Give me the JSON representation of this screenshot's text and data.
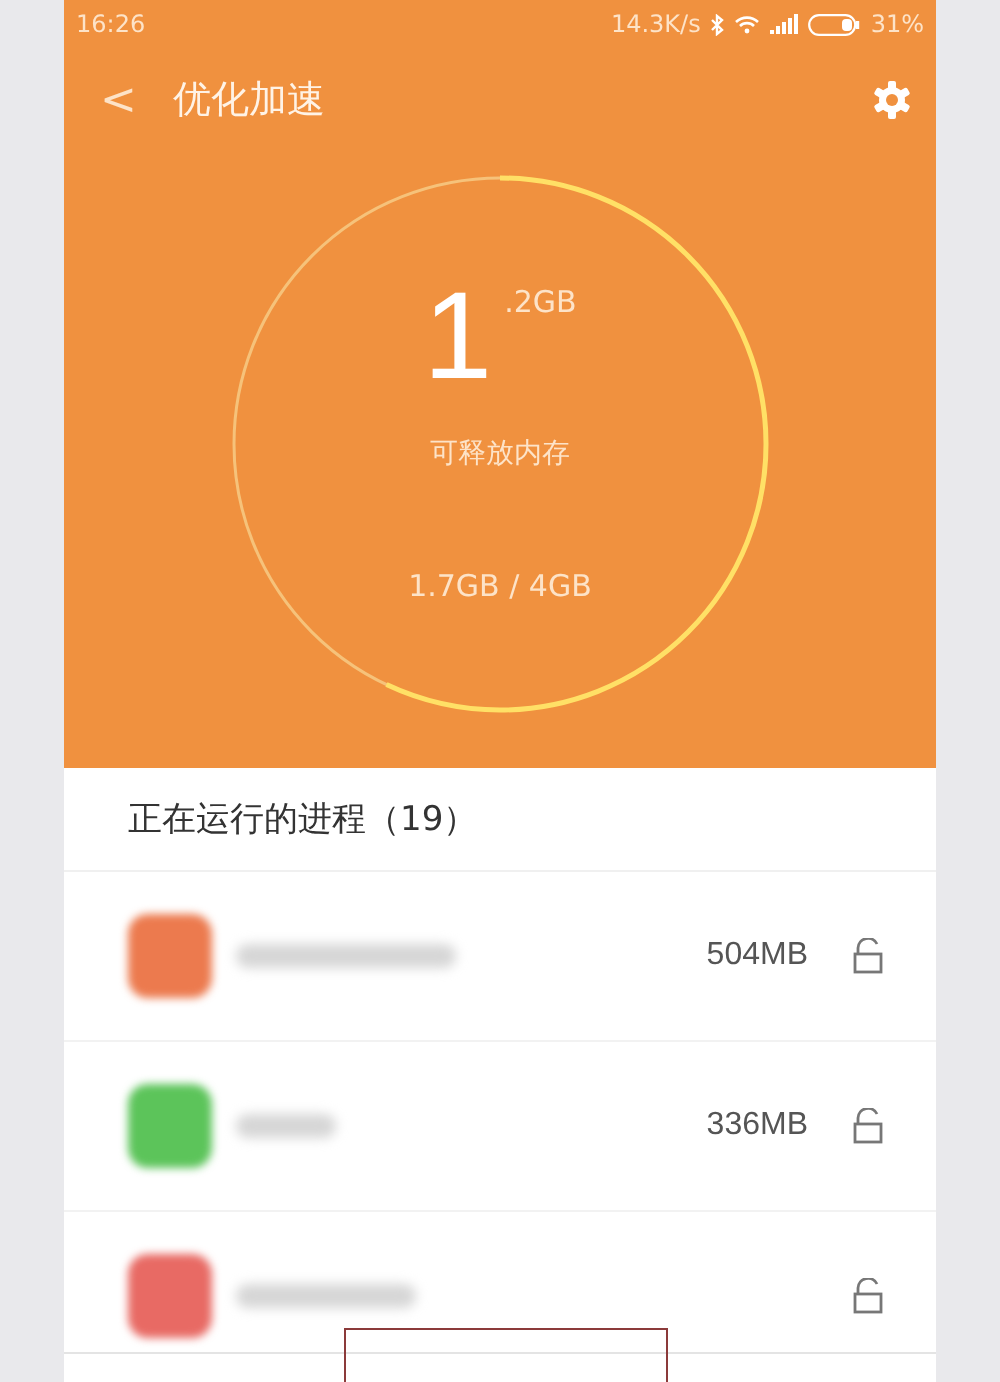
{
  "status_bar": {
    "time": "16:26",
    "speed": "14.3K/s",
    "battery": "31%"
  },
  "header": {
    "back": "<",
    "title": "优化加速"
  },
  "memory": {
    "big": "1",
    "small": ".2GB",
    "caption": "可释放内存",
    "usage": "1.7GB / 4GB",
    "level": 0.57
  },
  "processes": {
    "title": "正在运行的进程（19）",
    "items": [
      {
        "color": "#ec7a4e",
        "size": "504MB"
      },
      {
        "color": "#5cc45a",
        "size": "336MB"
      },
      {
        "color": "#e86a64"
      }
    ]
  }
}
